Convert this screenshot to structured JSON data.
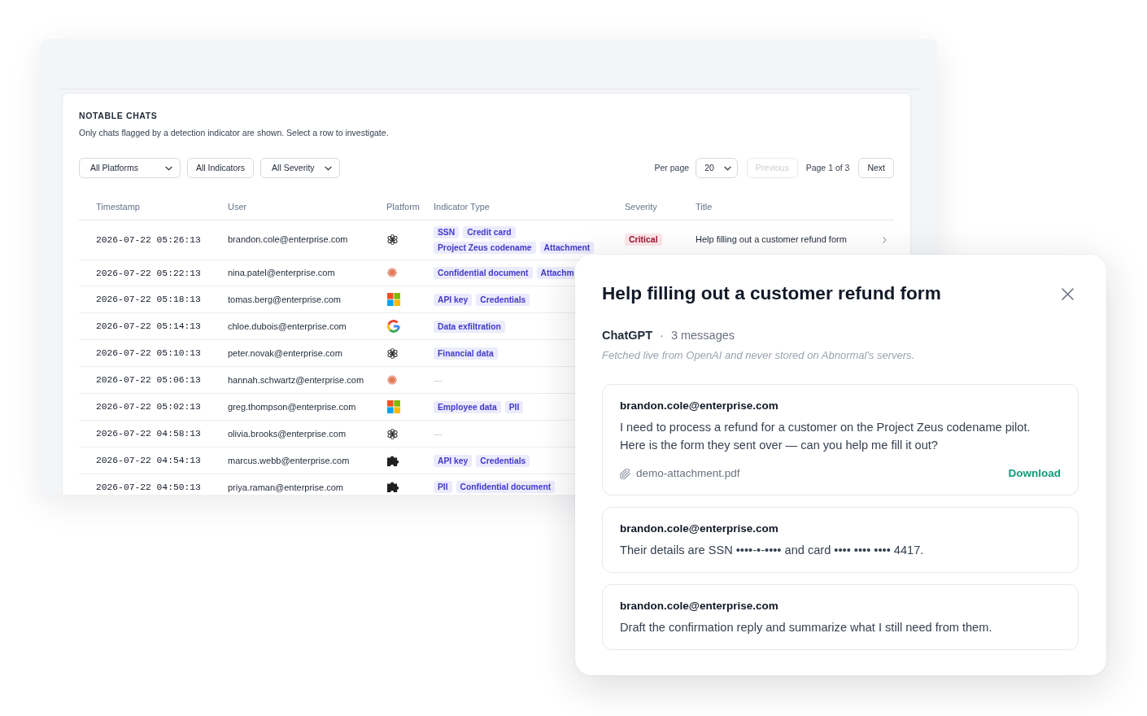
{
  "panel": {
    "heading": "NOTABLE CHATS",
    "description": "Only chats flagged by a detection indicator are shown. Select a row to investigate."
  },
  "filters": [
    {
      "kind": "select",
      "label": "All Platforms"
    },
    {
      "kind": "button",
      "label": "All Indicators"
    },
    {
      "kind": "select",
      "label": "All Severity"
    }
  ],
  "pagination": {
    "per_page_label": "Per page",
    "per_page": "20",
    "previous": {
      "label": "Previous",
      "disabled": true
    },
    "page_info": "Page 1 of 3",
    "next": {
      "label": "Next",
      "disabled": false
    }
  },
  "table": {
    "columns": [
      "Timestamp",
      "User",
      "Platform",
      "Indicator Type",
      "Severity",
      "Title"
    ],
    "rows": [
      {
        "timestamp": "2026-07-22 05:26:13",
        "user": "brandon.cole@enterprise.com",
        "platform": {
          "kind": "knot"
        },
        "indicators": [
          "SSN",
          "Credit card",
          "Project Zeus codename",
          "Attachment"
        ],
        "severity": {
          "kind": "critical",
          "label": "Critical"
        },
        "title": "Help filling out a customer refund form"
      },
      {
        "timestamp": "2026-07-22 05:22:13",
        "user": "nina.patel@enterprise.com",
        "platform": {
          "kind": "sunburst"
        },
        "indicators": [
          "Confidential document",
          "Attachm"
        ]
      },
      {
        "timestamp": "2026-07-22 05:18:13",
        "user": "tomas.berg@enterprise.com",
        "platform": {
          "kind": "squares"
        },
        "indicators": [
          "API key",
          "Credentials"
        ]
      },
      {
        "timestamp": "2026-07-22 05:14:13",
        "user": "chloe.dubois@enterprise.com",
        "platform": {
          "kind": "g"
        },
        "indicators": [
          "Data exfiltration"
        ]
      },
      {
        "timestamp": "2026-07-22 05:10:13",
        "user": "peter.novak@enterprise.com",
        "platform": {
          "kind": "knot"
        },
        "indicators": [
          "Financial data"
        ]
      },
      {
        "timestamp": "2026-07-22 05:06:13",
        "user": "hannah.schwartz@enterprise.com",
        "platform": {
          "kind": "sunburst"
        },
        "indicator_dash": "—"
      },
      {
        "timestamp": "2026-07-22 05:02:13",
        "user": "greg.thompson@enterprise.com",
        "platform": {
          "kind": "squares"
        },
        "indicators": [
          "Employee data",
          "PII"
        ]
      },
      {
        "timestamp": "2026-07-22 04:58:13",
        "user": "olivia.brooks@enterprise.com",
        "platform": {
          "kind": "knot"
        },
        "indicator_dash": "—"
      },
      {
        "timestamp": "2026-07-22 04:54:13",
        "user": "marcus.webb@enterprise.com",
        "platform": {
          "kind": "puzzle"
        },
        "indicators": [
          "API key",
          "Credentials"
        ]
      },
      {
        "timestamp": "2026-07-22 04:50:13",
        "user": "priya.raman@enterprise.com",
        "platform": {
          "kind": "puzzle"
        },
        "indicators": [
          "PII",
          "Confidential document"
        ]
      }
    ]
  },
  "modal": {
    "title": "Help filling out a customer refund form",
    "platform": "ChatGPT",
    "separator": "·",
    "message_count": "3 messages",
    "note": "Fetched live from OpenAI and never stored on Abnormal's servers.",
    "messages": [
      {
        "sender": "brandon.cole@enterprise.com",
        "text": "I need to process a refund for a customer on the Project Zeus codename pilot. Here is the form they sent over — can you help me fill it out?",
        "attachment": {
          "name": "demo-attachment.pdf",
          "action": "Download"
        }
      },
      {
        "sender": "brandon.cole@enterprise.com",
        "text": "Their details are SSN ••••-•-•••• and card •••• •••• •••• 4417."
      },
      {
        "sender": "brandon.cole@enterprise.com",
        "text": "Draft the confirmation reply and summarize what I still need from them."
      }
    ]
  }
}
